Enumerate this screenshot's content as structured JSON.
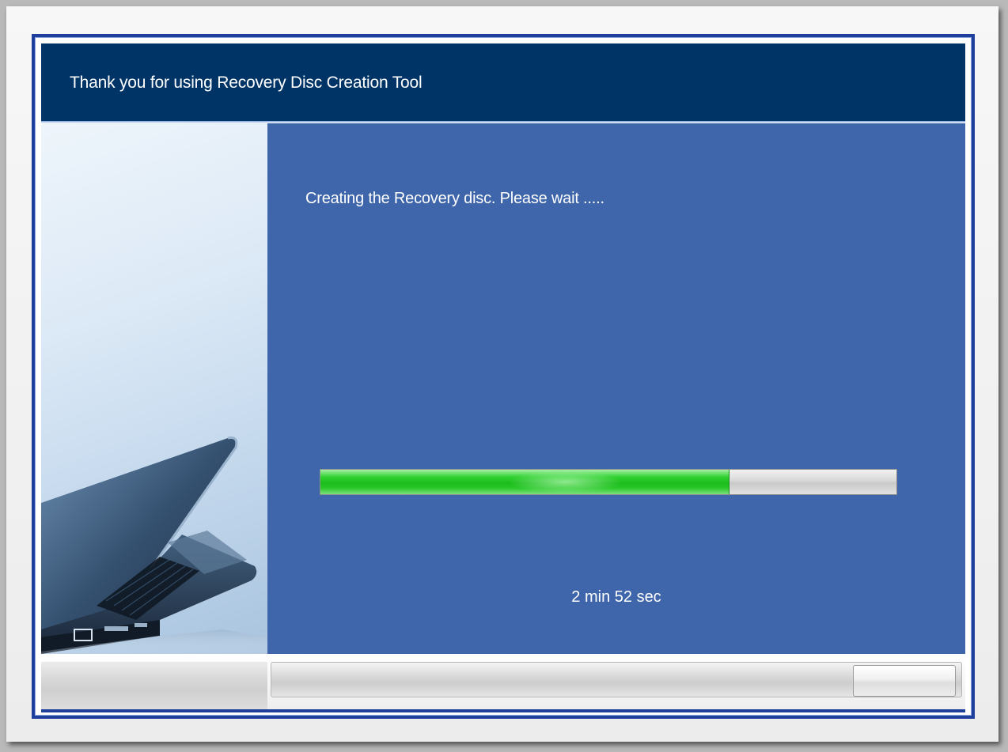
{
  "window": {
    "title": "Thank you for using Recovery Disc Creation Tool"
  },
  "main": {
    "status_message": "Creating the Recovery disc. Please wait .....",
    "progress_percent": 71,
    "remaining_time": "2 min 52 sec"
  },
  "footer": {
    "button_label": ""
  },
  "colors": {
    "title_bar": "#003466",
    "main_panel": "#3f66aa",
    "window_border": "#1e3f9a",
    "progress_fill": "#22c422"
  },
  "icons": {
    "side_illustration": "laptop-illustration"
  }
}
